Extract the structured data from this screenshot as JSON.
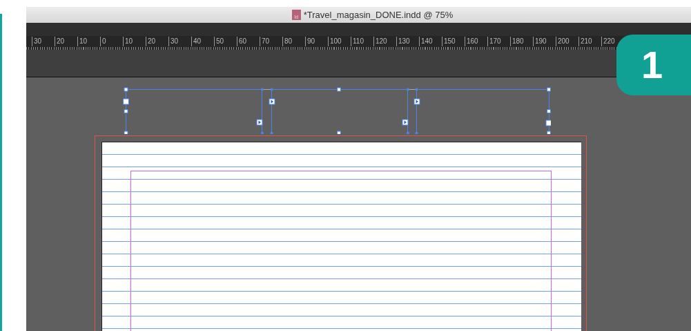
{
  "window": {
    "title": "*Travel_magasin_DONE.indd @ 75%",
    "file_icon_text": "Id"
  },
  "ruler": {
    "labels": [
      "30",
      "20",
      "10",
      "0",
      "10",
      "20",
      "30",
      "40",
      "50",
      "60",
      "70",
      "80",
      "90",
      "100",
      "110",
      "120",
      "130",
      "140",
      "150",
      "160",
      "170",
      "180",
      "190",
      "200",
      "210",
      "220"
    ]
  },
  "step_badge": "1"
}
